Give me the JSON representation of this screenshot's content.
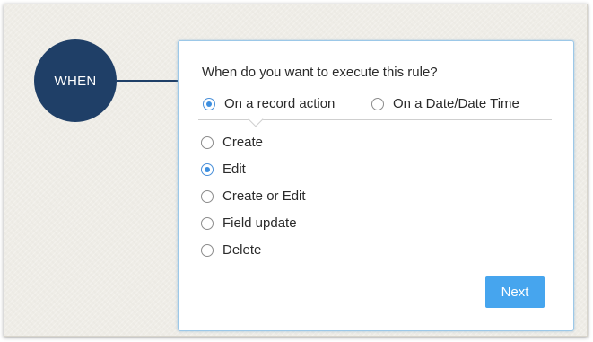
{
  "workflow": {
    "step_label": "WHEN",
    "accent_color": "#1f3f67"
  },
  "rule": {
    "question": "When do you want to execute this rule?",
    "trigger_types": [
      {
        "label": "On a record action",
        "checked": true
      },
      {
        "label": "On a Date/Date Time",
        "checked": false
      }
    ],
    "actions": [
      {
        "label": "Create",
        "checked": false
      },
      {
        "label": "Edit",
        "checked": true
      },
      {
        "label": "Create or Edit",
        "checked": false
      },
      {
        "label": "Field update",
        "checked": false
      },
      {
        "label": "Delete",
        "checked": false
      }
    ],
    "next_label": "Next",
    "button_color": "#46a5ee"
  }
}
